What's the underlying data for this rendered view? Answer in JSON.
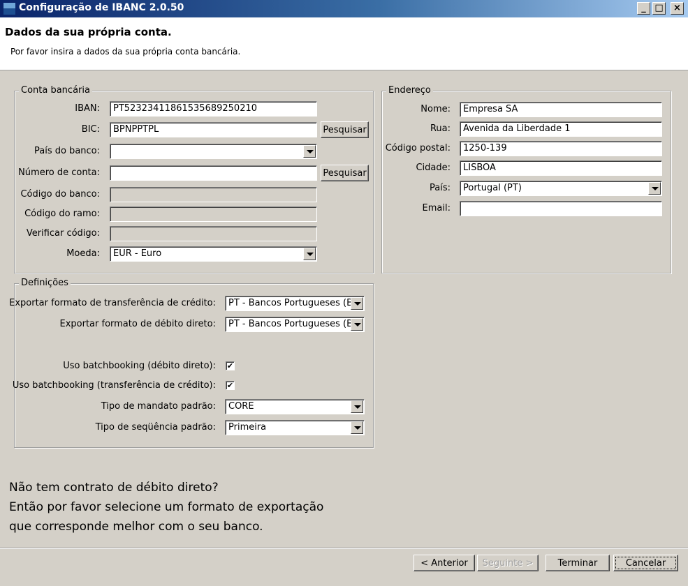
{
  "window": {
    "title": "Configuração de IBANC 2.0.50",
    "minimize": "_",
    "maximize": "□",
    "close": "×"
  },
  "header": {
    "title": "Dados da sua própria conta.",
    "subtitle": "Por favor insira a dados da sua própria conta bancária."
  },
  "bank_account": {
    "legend": "Conta bancária",
    "iban_label": "IBAN:",
    "iban_value": "PT52323411861535689250210",
    "bic_label": "BIC:",
    "bic_value": "BPNPPTPL",
    "search_label": "Pesquisar",
    "bank_country_label": "País do banco:",
    "bank_country_value": "",
    "account_number_label": "Número de conta:",
    "account_number_value": "",
    "bank_code_label": "Código do banco:",
    "branch_code_label": "Código do ramo:",
    "check_code_label": "Verificar código:",
    "currency_label": "Moeda:",
    "currency_value": "EUR - Euro"
  },
  "address": {
    "legend": "Endereço",
    "name_label": "Nome:",
    "name_value": "Empresa SA",
    "street_label": "Rua:",
    "street_value": "Avenida da Liberdade 1",
    "postal_label": "Código postal:",
    "postal_value": "1250-139",
    "city_label": "Cidade:",
    "city_value": "LISBOA",
    "country_label": "País:",
    "country_value": "Portugal (PT)",
    "email_label": "Email:",
    "email_value": ""
  },
  "settings": {
    "legend": "Definições",
    "credit_format_label": "Exportar formato de transferência de crédito:",
    "credit_format_value": "PT - Bancos Portugueses (Bc",
    "debit_format_label": "Exportar formato de débito direto:",
    "debit_format_value": "PT - Bancos Portugueses (Bc",
    "batch_debit_label": "Uso batchbooking (débito direto):",
    "batch_debit_checked": true,
    "batch_credit_label": "Uso batchbooking (transferência de crédito):",
    "batch_credit_checked": true,
    "mandate_type_label": "Tipo de mandato padrão:",
    "mandate_type_value": "CORE",
    "sequence_type_label": "Tipo de seqüência padrão:",
    "sequence_type_value": "Primeira"
  },
  "info": {
    "line1": "Não tem contrato de débito direto?",
    "line2": "Então por favor selecione um formato de exportação",
    "line3": "que corresponde melhor com o seu banco."
  },
  "footer": {
    "back_label": "< Anterior",
    "next_label": "Seguinte >",
    "finish_label": "Terminar",
    "cancel_label": "Cancelar"
  },
  "icons": {
    "check_mark": "✔"
  }
}
